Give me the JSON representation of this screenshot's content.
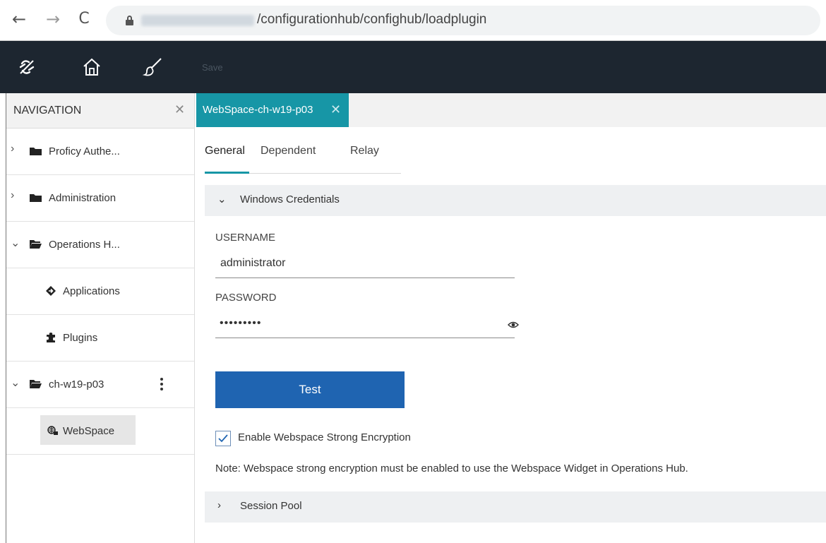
{
  "browser": {
    "url_path": "/configurationhub/confighub/loadplugin",
    "back_glyph": "←",
    "forward_glyph": "→",
    "reload_glyph": "C"
  },
  "toolbar": {
    "save_label": "Save",
    "icons": [
      "confighub-logo-icon",
      "home-icon",
      "brush-icon"
    ]
  },
  "navigation": {
    "title": "NAVIGATION",
    "close_glyph": "✕",
    "items": [
      {
        "label": "Proficy Authe...",
        "expand": "›",
        "icon": "folder-icon"
      },
      {
        "label": "Administration",
        "expand": "›",
        "icon": "folder-icon"
      },
      {
        "label": "Operations H...",
        "expand": "⌄",
        "icon": "folder-open-icon"
      },
      {
        "label": "Applications",
        "icon": "applications-icon"
      },
      {
        "label": "Plugins",
        "icon": "puzzle-icon"
      },
      {
        "label": "ch-w19-p03",
        "expand": "⌄",
        "icon": "folder-open-icon"
      },
      {
        "label": "WebSpace",
        "icon": "webspace-icon"
      }
    ]
  },
  "document_tab": {
    "label": "WebSpace-ch-w19-p03",
    "close_glyph": "✕"
  },
  "subtabs": {
    "general": "General",
    "dependent": "Dependent",
    "relay": "Relay",
    "active": "General"
  },
  "sections": {
    "credentials": {
      "label": "Windows Credentials",
      "chevron": "⌄",
      "expanded": true
    },
    "session_pool": {
      "label": "Session Pool",
      "chevron": "›",
      "expanded": false
    }
  },
  "form": {
    "username_label": "USERNAME",
    "username_value": "administrator",
    "password_label": "PASSWORD",
    "password_mask": "•••••••••"
  },
  "test_button": "Test",
  "encryption": {
    "checked": true,
    "label": "Enable Webspace Strong Encryption",
    "note": "Note: Webspace strong encryption must be enabled to use the Webspace Widget in Operations Hub."
  },
  "colors": {
    "toolbar_bg": "#1d2630",
    "tab_teal": "#1796a6",
    "button_blue": "#1f64b1"
  }
}
